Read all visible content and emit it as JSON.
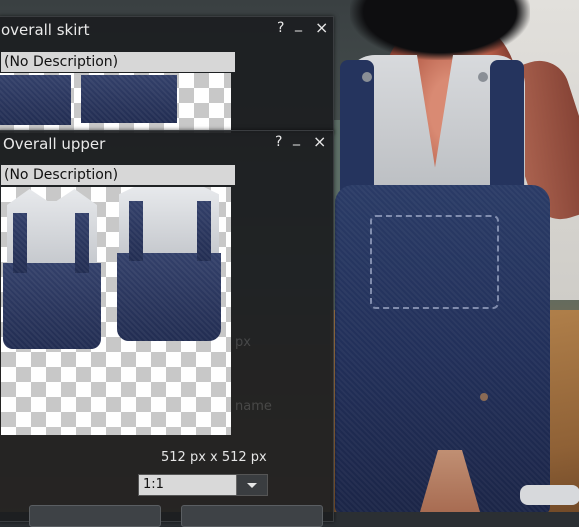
{
  "floaters": {
    "skirt": {
      "title": "overall skirt",
      "description": "(No Description)",
      "help_glyph": "?",
      "minimize_glyph": "_",
      "close_glyph": "×"
    },
    "upper": {
      "title": "Overall upper",
      "description": "(No Description)",
      "help_glyph": "?",
      "minimize_glyph": "_",
      "close_glyph": "×",
      "dimensions_text": "512 px x 512 px",
      "zoom": {
        "selected": "1:1"
      }
    }
  },
  "colors": {
    "floater_bg": "#1c1e20",
    "description_bg": "#d7d7d7",
    "denim": "#2a3b66"
  }
}
